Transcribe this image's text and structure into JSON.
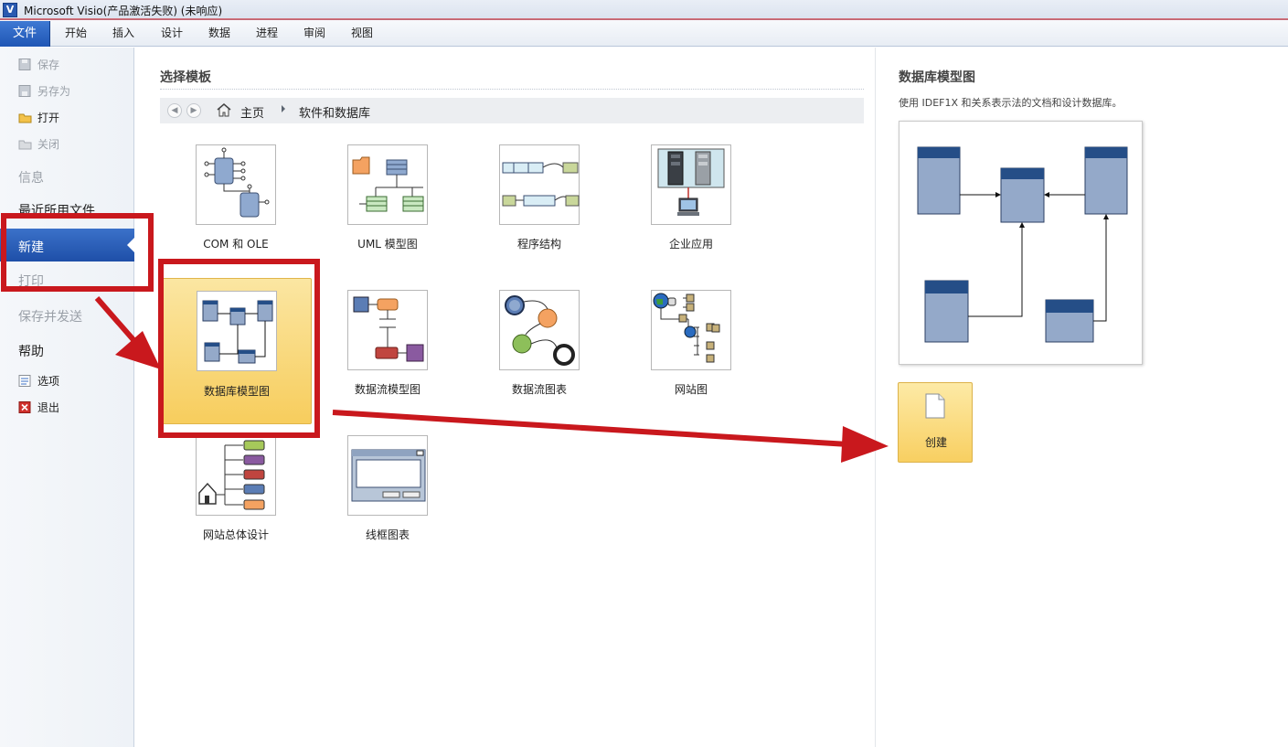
{
  "window": {
    "title": "Microsoft Visio(产品激活失败) (未响应)",
    "app_icon": "V"
  },
  "ribbon": {
    "file_tab": "文件",
    "tabs": [
      "开始",
      "插入",
      "设计",
      "数据",
      "进程",
      "审阅",
      "视图"
    ]
  },
  "nav": {
    "save": "保存",
    "save_as": "另存为",
    "open": "打开",
    "close": "关闭",
    "info": "信息",
    "recent": "最近所用文件",
    "new": "新建",
    "print": "打印",
    "save_send": "保存并发送",
    "help": "帮助",
    "options": "选项",
    "exit": "退出"
  },
  "main": {
    "section_title": "选择模板",
    "breadcrumb": {
      "home": "主页",
      "current": "软件和数据库"
    },
    "templates": [
      {
        "label": "COM 和 OLE"
      },
      {
        "label": "UML 模型图"
      },
      {
        "label": "程序结构"
      },
      {
        "label": "企业应用"
      },
      {
        "label": "数据库模型图",
        "selected": true
      },
      {
        "label": "数据流模型图"
      },
      {
        "label": "数据流图表"
      },
      {
        "label": "网站图"
      },
      {
        "label": "网站总体设计"
      },
      {
        "label": "线框图表"
      }
    ]
  },
  "right_panel": {
    "title": "数据库模型图",
    "description": "使用 IDEF1X 和关系表示法的文档和设计数据库。",
    "create_label": "创建"
  },
  "colors": {
    "accent": "#1f56b5",
    "highlight": "#f8cf61",
    "annotation_red": "#c9181d"
  }
}
